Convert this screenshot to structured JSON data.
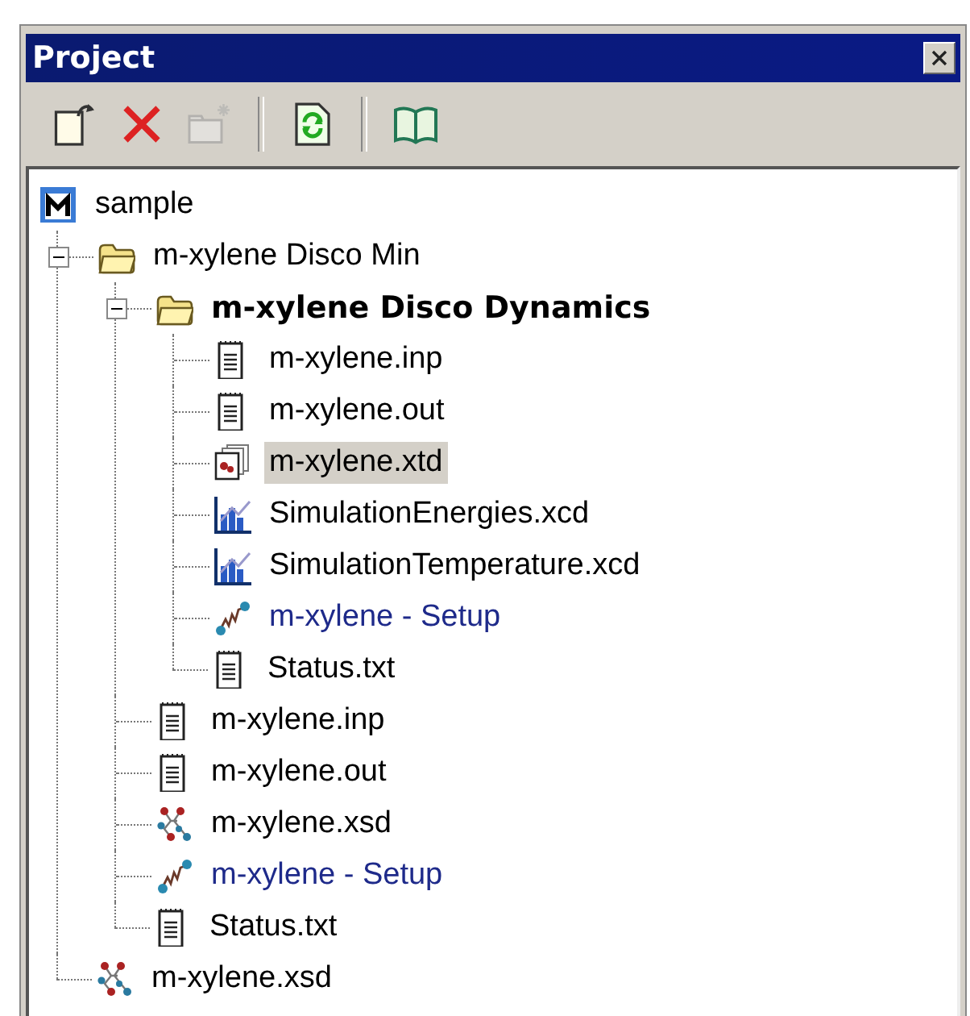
{
  "window": {
    "title": "Project"
  },
  "toolbar": [
    [
      {
        "kind": "new",
        "disabled": false
      },
      {
        "kind": "delete",
        "disabled": false
      },
      {
        "kind": "new-folder",
        "disabled": true
      }
    ],
    [
      {
        "kind": "refresh",
        "disabled": false
      }
    ],
    [
      {
        "kind": "book",
        "disabled": false
      }
    ]
  ],
  "tree": {
    "label": "sample",
    "kind": "project",
    "selected": false,
    "active": false,
    "children": [
      {
        "label": "m-xylene Disco Min",
        "kind": "folder",
        "selected": false,
        "active": false,
        "expanded": true,
        "children": [
          {
            "label": "m-xylene Disco Dynamics",
            "kind": "folder",
            "selected": false,
            "active": true,
            "expanded": true,
            "children": [
              {
                "label": "m-xylene.inp",
                "kind": "text",
                "selected": false,
                "active": false
              },
              {
                "label": "m-xylene.out",
                "kind": "text",
                "selected": false,
                "active": false
              },
              {
                "label": "m-xylene.xtd",
                "kind": "trajectory",
                "selected": true,
                "active": false
              },
              {
                "label": "SimulationEnergies.xcd",
                "kind": "chart",
                "selected": false,
                "active": false
              },
              {
                "label": "SimulationTemperature.xcd",
                "kind": "chart",
                "selected": false,
                "active": false
              },
              {
                "label": "m-xylene - Setup",
                "kind": "setup",
                "selected": false,
                "active": false
              },
              {
                "label": "Status.txt",
                "kind": "text",
                "selected": false,
                "active": false
              }
            ]
          },
          {
            "label": "m-xylene.inp",
            "kind": "text",
            "selected": false,
            "active": false
          },
          {
            "label": "m-xylene.out",
            "kind": "text",
            "selected": false,
            "active": false
          },
          {
            "label": "m-xylene.xsd",
            "kind": "structure",
            "selected": false,
            "active": false
          },
          {
            "label": "m-xylene - Setup",
            "kind": "setup",
            "selected": false,
            "active": false
          },
          {
            "label": "Status.txt",
            "kind": "text",
            "selected": false,
            "active": false
          }
        ]
      },
      {
        "label": "m-xylene.xsd",
        "kind": "structure",
        "selected": false,
        "active": false
      }
    ]
  }
}
